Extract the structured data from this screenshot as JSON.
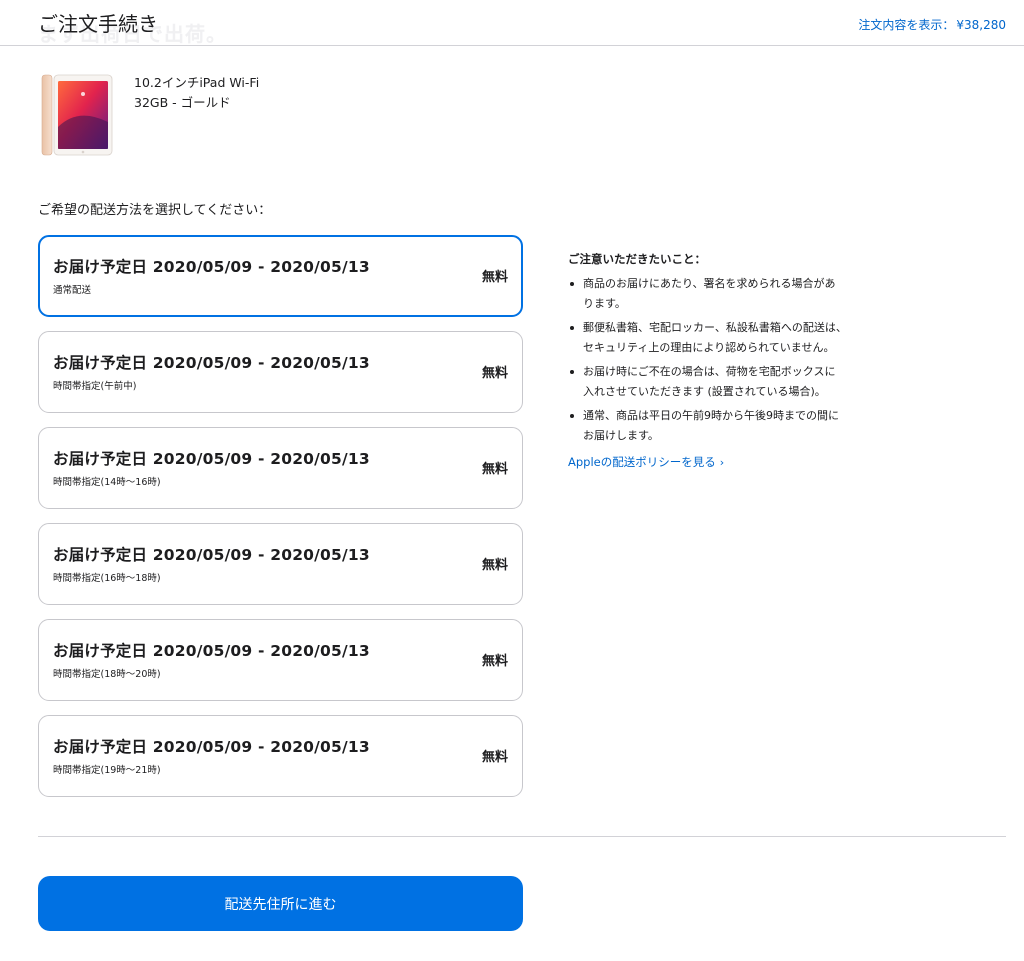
{
  "header": {
    "title": "ご注文手続き",
    "ghost_text": "まず出荷日で出荷。",
    "summary_label": "注文内容を表示：",
    "summary_price": "¥38,280"
  },
  "product": {
    "name": "10.2インチiPad Wi-Fi",
    "variant": "32GB - ゴールド"
  },
  "shipping": {
    "prompt": "ご希望の配送方法を選択してください：",
    "options": [
      {
        "title": "お届け予定日 2020/05/09 - 2020/05/13",
        "subtitle": "通常配送",
        "price": "無料",
        "selected": true
      },
      {
        "title": "お届け予定日 2020/05/09 - 2020/05/13",
        "subtitle": "時間帯指定(午前中)",
        "price": "無料",
        "selected": false
      },
      {
        "title": "お届け予定日 2020/05/09 - 2020/05/13",
        "subtitle": "時間帯指定(14時〜16時)",
        "price": "無料",
        "selected": false
      },
      {
        "title": "お届け予定日 2020/05/09 - 2020/05/13",
        "subtitle": "時間帯指定(16時〜18時)",
        "price": "無料",
        "selected": false
      },
      {
        "title": "お届け予定日 2020/05/09 - 2020/05/13",
        "subtitle": "時間帯指定(18時〜20時)",
        "price": "無料",
        "selected": false
      },
      {
        "title": "お届け予定日 2020/05/09 - 2020/05/13",
        "subtitle": "時間帯指定(19時〜21時)",
        "price": "無料",
        "selected": false
      }
    ]
  },
  "notes": {
    "heading": "ご注意いただきたいこと：",
    "items": [
      [
        "商品のお届けにあたり、署名を求められる場合があ",
        "ります。"
      ],
      [
        "郵便私書箱、宅配ロッカー、私設私書箱への配送は、",
        "セキュリティ上の理由により認められていません。"
      ],
      [
        "お届け時にご不在の場合は、荷物を宅配ボックスに",
        "入れさせていただきます (設置されている場合)。"
      ],
      [
        "通常、商品は平日の午前9時から午後9時までの間に",
        "お届けします。"
      ]
    ],
    "link": "Appleの配送ポリシーを見る",
    "link_icon": "chevron-right-icon"
  },
  "continue_button": "配送先住所に進む",
  "colors": {
    "accent": "#0071e3",
    "link": "#0066cc",
    "border": "#c7c7cc",
    "text": "#1d1d1f"
  }
}
